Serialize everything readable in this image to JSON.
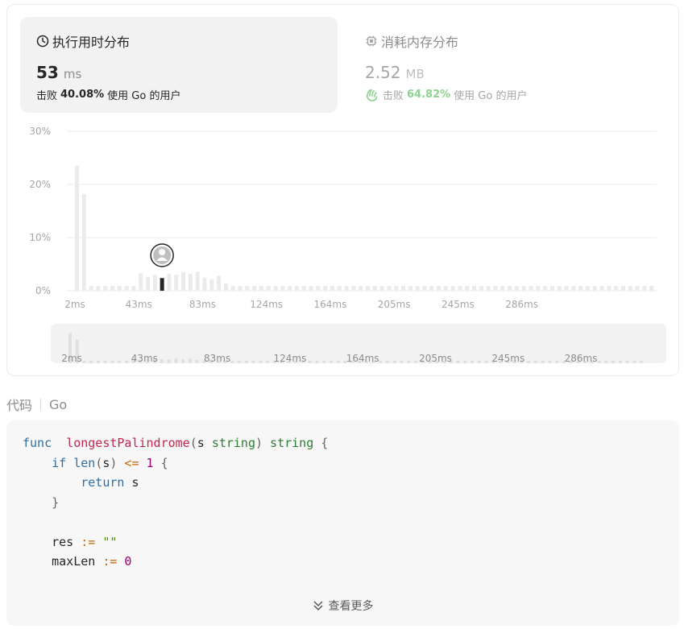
{
  "runtime": {
    "title": "执行用时分布",
    "value": "53",
    "unit": "ms",
    "beat_prefix": "击败",
    "beat_percent": "40.08%",
    "beat_suffix": "使用 Go 的用户",
    "icon": "clock-icon"
  },
  "memory": {
    "title": "消耗内存分布",
    "value": "2.52",
    "unit": "MB",
    "beat_prefix": "击败",
    "beat_percent": "64.82%",
    "beat_suffix": "使用 Go 的用户",
    "icon": "chip-icon",
    "hand_icon": "clap-hands-icon",
    "accent": "#8fd18f"
  },
  "chart_data": {
    "type": "bar",
    "ylim": [
      0,
      30
    ],
    "ytick_labels": [
      "30%",
      "20%",
      "10%",
      "0%"
    ],
    "xtick_labels": [
      "2ms",
      "43ms",
      "83ms",
      "124ms",
      "164ms",
      "205ms",
      "245ms",
      "286ms"
    ],
    "values": [
      23.5,
      18.2,
      0.9,
      0.9,
      0.9,
      0.9,
      0.9,
      0.9,
      0.9,
      3.3,
      2.6,
      3.0,
      3.3,
      3.2,
      3.0,
      3.5,
      3.2,
      3.6,
      2.5,
      2.2,
      2.8,
      1.4,
      0.9,
      0.9,
      0.9,
      0.9,
      0.9,
      0.9,
      0.9,
      0.9,
      0.9,
      0.9,
      0.9,
      0.9,
      0.9,
      0.9,
      0.9,
      0.9,
      0.9,
      0.9,
      0.9,
      0.9,
      0.9,
      0.9,
      0.9,
      0.9,
      0.9,
      0.9,
      0.9,
      0.9,
      0.9,
      0.9,
      0.9,
      0.9,
      0.9,
      0.9,
      0.9,
      0.9,
      0.9,
      0.9,
      0.9,
      0.9,
      0.9,
      0.9,
      0.9,
      0.9,
      0.9,
      0.9,
      0.9,
      0.9,
      0.9,
      0.9,
      0.9,
      0.9,
      0.9,
      0.9,
      0.9,
      0.9,
      0.9,
      0.9,
      0.9,
      0.9
    ],
    "highlight_index": 12,
    "bar_color": "#ebebeb",
    "highlight_color": "#262626",
    "grid": true,
    "brush_xtick_labels": [
      "2ms",
      "43ms",
      "83ms",
      "124ms",
      "164ms",
      "205ms",
      "245ms",
      "286ms"
    ]
  },
  "code_section": {
    "label": "代码",
    "language": "Go",
    "more_label": "查看更多",
    "more_icon": "chevron-double-down-icon",
    "lines": [
      [
        [
          "kw",
          "func"
        ],
        [
          "",
          "  "
        ],
        [
          "fn",
          "longestPalindrome"
        ],
        [
          "pun",
          "("
        ],
        [
          "",
          "s "
        ],
        [
          "ty",
          "string"
        ],
        [
          "pun",
          ")"
        ],
        [
          "",
          ""
        ],
        [
          "ty",
          " string"
        ],
        [
          "pun",
          " {"
        ]
      ],
      [
        [
          "",
          "    "
        ],
        [
          "kw",
          "if"
        ],
        [
          "",
          ""
        ],
        [
          "bi",
          " len"
        ],
        [
          "pun",
          "("
        ],
        [
          "",
          "s"
        ],
        [
          "pun",
          ")"
        ],
        [
          "op",
          " <="
        ],
        [
          "num",
          " 1"
        ],
        [
          "pun",
          " {"
        ]
      ],
      [
        [
          "",
          "        "
        ],
        [
          "kw",
          "return"
        ],
        [
          "",
          ""
        ],
        [
          "",
          ""
        ],
        [
          "",
          " s"
        ]
      ],
      [
        [
          "",
          "    "
        ],
        [
          "pun",
          "}"
        ]
      ],
      [
        [
          "",
          ""
        ]
      ],
      [
        [
          "",
          "    res "
        ],
        [
          "op",
          ":="
        ],
        [
          "str",
          " \"\""
        ]
      ],
      [
        [
          "",
          "    maxLen "
        ],
        [
          "op",
          ":="
        ],
        [
          "num",
          " 0"
        ]
      ]
    ]
  }
}
